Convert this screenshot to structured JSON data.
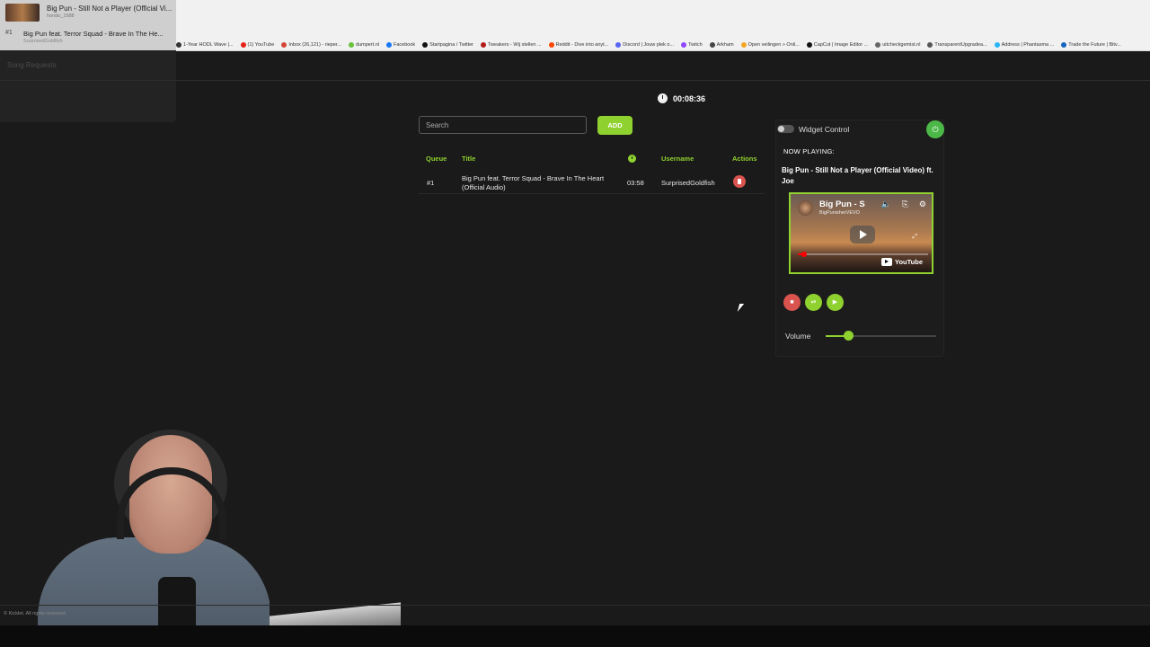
{
  "browser": {
    "bookmarks": [
      {
        "label": "1-Year HODL Wave |...",
        "color": "#333333"
      },
      {
        "label": "(1) YouTube",
        "color": "#e62117"
      },
      {
        "label": "Inbox (26,121) - rieper...",
        "color": "#d44638"
      },
      {
        "label": "dumpert.nl",
        "color": "#66c33a"
      },
      {
        "label": "Facebook",
        "color": "#1877f2"
      },
      {
        "label": "Startpagina / Twitter",
        "color": "#111111"
      },
      {
        "label": "Tweakers - Wij stellen ...",
        "color": "#b31b1b"
      },
      {
        "label": "Reddit - Dive into anyt...",
        "color": "#ff4500"
      },
      {
        "label": "Discord | Jouw plek o...",
        "color": "#5865f2"
      },
      {
        "label": "Twitch",
        "color": "#9146ff"
      },
      {
        "label": "Arkham",
        "color": "#444444"
      },
      {
        "label": "Open veilingen » Onli...",
        "color": "#f5a623"
      },
      {
        "label": "CapCut | Image Editor ...",
        "color": "#111111"
      },
      {
        "label": "uitcheckgemist.nl",
        "color": "#666666"
      },
      {
        "label": "TransparentUpgradea...",
        "color": "#555555"
      },
      {
        "label": "Address | Phantasma ...",
        "color": "#29b6f6"
      },
      {
        "label": "Trade the Future | Bitv...",
        "color": "#1565c0"
      }
    ]
  },
  "mini_player": {
    "title": "Big Pun - Still Not a Player (Official Vi...",
    "subtitle": "hondo_1988",
    "queue_num": "#1",
    "queue_title": "Big Pun feat. Terror Squad - Brave In The He...",
    "queue_sub": "SurprisedGoldfish",
    "section_label": "Song Requests"
  },
  "timer": "00:08:36",
  "search": {
    "placeholder": "Search",
    "add_label": "ADD"
  },
  "table": {
    "headers": {
      "queue": "Queue",
      "title": "Title",
      "username": "Username",
      "actions": "Actions"
    },
    "rows": [
      {
        "queue": "#1",
        "title_line1": "Big Pun feat. Terror Squad - Brave In The Heart",
        "title_line2": "(Official Audio)",
        "duration": "03:58",
        "username": "SurprisedGoldfish"
      }
    ]
  },
  "widget": {
    "control_label": "Widget Control",
    "control_on": false,
    "now_playing_label": "NOW PLAYING:",
    "now_playing_title": "Big Pun - Still Not a Player (Official Video) ft. Joe",
    "video": {
      "title": "Big Pun - S",
      "channel": "BigPunisherVEVO",
      "brand": "YouTube",
      "progress": 0.05
    },
    "volume_label": "Volume",
    "volume": 0.2
  },
  "footer": "© Kicklet. All rights reserved.",
  "colors": {
    "accent": "#8fd12f",
    "danger": "#d9534f",
    "power": "#4cb848",
    "background": "#1a1a1a"
  }
}
